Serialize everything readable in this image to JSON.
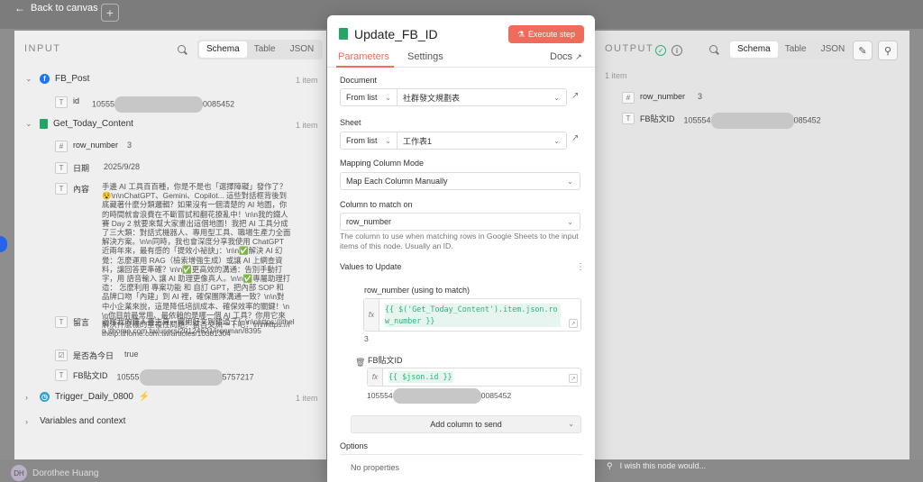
{
  "topbar": {
    "back_label": "Back to canvas",
    "plus": "+"
  },
  "bottombar": {
    "user_initials": "DH",
    "user_name": "Dorothee Huang"
  },
  "input": {
    "title": "INPUT",
    "views": [
      "Schema",
      "Table",
      "JSON"
    ],
    "active_view": "Schema",
    "nodes": {
      "fb_post": {
        "name": "FB_Post",
        "count": "1 item",
        "fields": [
          {
            "type": "T",
            "name": "id",
            "val_prefix": "10555",
            "val_suffix": "0085452"
          }
        ]
      },
      "get_today": {
        "name": "Get_Today_Content",
        "count": "1 item",
        "row_number": {
          "type": "#",
          "name": "row_number",
          "value": "3"
        },
        "date": {
          "type": "T",
          "name": "日期",
          "value": "2025/9/28"
        },
        "content": {
          "type": "T",
          "name": "內容",
          "value": "手邊 AI 工具百百種，你是不是也「選擇障礙」發作了？😵\\n\\nChatGPT、Gemini、Copilot... 這些對話框背後到底藏著什麼分類邏輯？如果沒有一個清楚的 AI 地圖，你的時間就會浪費在不斷嘗試和翻花撩亂中！\\n\\n我的鐵人賽 Day 2 就要來幫大家畫出這個地圖！我把 AI 工具分成了三大類：對話式機器人、專用型工具、職場生產力全面解決方案。\\n\\n同時，我也會深度分享我使用 ChatGPT 近兩年來，最有感的「提效小祕訣」：\\n\\n✅解決 AI 幻覺：怎麼運用 RAG（檢索增強生成）或讓 AI 上網查資料，讓回答更準確？\\n\\n✅更高效的溝通：告別手動打字，用 語音輸入 讓 AI 助理更像真人。\\n\\n✅專屬助理打造： 怎麼利用 專案功能 和 自訂 GPT，把內部 SOP 和品牌口吻「內建」到 AI 裡，確保團隊溝通一致？\\n\\n對中小企業來說，這是降低培訓成本、確保效率的關鍵！\\n\\n你目前最常用、最依賴的是哪一個 AI 工具？你用它來解決什麼樣的重複性問題？留言交流一下吧！\\n\\nhttps://ithelp.ithome.com.tw/articles/10381304"
        },
        "liuyan": {
          "type": "T",
          "name": "留言",
          "value": "追蹤我的鐵人賽主頁，實用好文別錯過了！\\n\\nhttps://ithelp.ithome.com.tw/users/20124621/ironman/8395"
        },
        "is_today": {
          "type": "☑",
          "name": "是否為今日",
          "value": "true"
        },
        "fb_id": {
          "type": "T",
          "name": "FB貼文ID",
          "val_prefix": "10555",
          "val_suffix": "5757217"
        }
      },
      "trigger": {
        "name": "Trigger_Daily_0800",
        "count": "1 item"
      },
      "variables": {
        "name": "Variables and context"
      }
    }
  },
  "modal": {
    "title": "Update_FB_ID",
    "execute_label": "Execute step",
    "tabs": [
      "Parameters",
      "Settings"
    ],
    "docs_label": "Docs",
    "document": {
      "label": "Document",
      "mode": "From list",
      "value": "社群發文規劃表"
    },
    "sheet": {
      "label": "Sheet",
      "mode": "From list",
      "value": "工作表1"
    },
    "mapping": {
      "label": "Mapping Column Mode",
      "value": "Map Each Column Manually"
    },
    "match": {
      "label": "Column to match on",
      "value": "row_number",
      "hint": "The column to use when matching rows in Google Sheets to the input items of this node. Usually an ID."
    },
    "values": {
      "title": "Values to Update",
      "row_number": {
        "label": "row_number (using to match)",
        "expr": "{{ $('Get_Today_Content').item.json.row_number }}",
        "result": "3"
      },
      "fb_id": {
        "label": "FB貼文ID",
        "expr": "{{ $json.id }}",
        "result_prefix": "105554",
        "result_suffix": "0085452"
      }
    },
    "add_column_label": "Add column to send",
    "options_title": "Options",
    "no_properties": "No properties"
  },
  "output": {
    "title": "OUTPUT",
    "views": [
      "Schema",
      "Table",
      "JSON"
    ],
    "active_view": "Schema",
    "count": "1 item",
    "fields": {
      "row_number": {
        "type": "#",
        "name": "row_number",
        "value": "3"
      },
      "fb_id": {
        "type": "T",
        "name": "FB貼文ID",
        "val_prefix": "105554",
        "val_suffix": "085452"
      }
    },
    "feedback_label": "I wish this node would..."
  },
  "colors": {
    "accent": "#ef6b5a",
    "sheets_green": "#23a566",
    "fb_blue": "#1877f2",
    "expr_green": "#2eb37b"
  }
}
